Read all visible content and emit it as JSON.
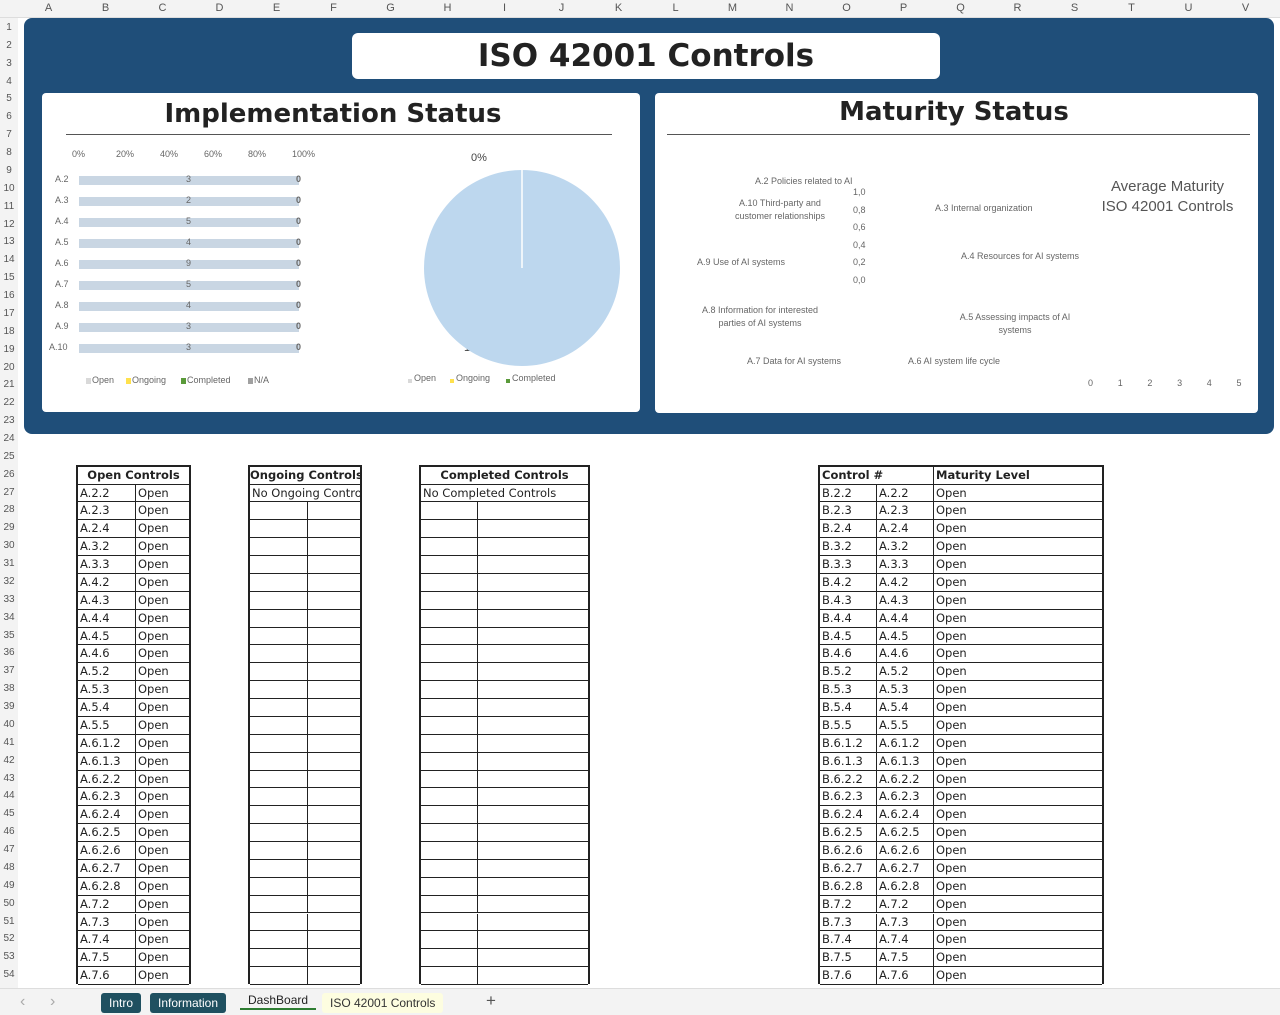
{
  "columns": [
    "A",
    "B",
    "C",
    "D",
    "E",
    "F",
    "G",
    "H",
    "I",
    "J",
    "K",
    "L",
    "M",
    "N",
    "O",
    "P",
    "Q",
    "R",
    "S",
    "T",
    "U",
    "V"
  ],
  "row_count": 54,
  "dashboard": {
    "title": "ISO 42001 Controls",
    "implementation_title": "Implementation Status",
    "maturity_title": "Maturity Status",
    "colors": {
      "background": "#1f4e79",
      "bar": "#c9d6e3",
      "pie": "#bdd7ee"
    }
  },
  "chart_data": [
    {
      "type": "bar",
      "stacked_percent": true,
      "categories": [
        "A.2",
        "A.3",
        "A.4",
        "A.5",
        "A.6",
        "A.7",
        "A.8",
        "A.9",
        "A.10"
      ],
      "xticks": [
        "0%",
        "20%",
        "40%",
        "60%",
        "80%",
        "100%"
      ],
      "series": [
        {
          "name": "Open",
          "values": [
            3,
            2,
            5,
            4,
            9,
            5,
            4,
            3,
            3
          ]
        },
        {
          "name": "Ongoing",
          "values": [
            0,
            0,
            0,
            0,
            0,
            0,
            0,
            0,
            0
          ]
        },
        {
          "name": "Completed",
          "values": [
            0,
            0,
            0,
            0,
            0,
            0,
            0,
            0,
            0
          ]
        },
        {
          "name": "N/A",
          "values": [
            0,
            0,
            0,
            0,
            0,
            0,
            0,
            0,
            0
          ]
        }
      ],
      "end_labels": [
        "0",
        "0",
        "0",
        "0",
        "0",
        "0",
        "0",
        "0",
        "0"
      ],
      "legend": [
        "Open",
        "Ongoing",
        "Completed",
        "N/A"
      ],
      "legend_position": "bottom"
    },
    {
      "type": "pie",
      "slices": [
        {
          "name": "Open",
          "value": 100,
          "label": "100%"
        },
        {
          "name": "Ongoing",
          "value": 0,
          "label": "0%"
        },
        {
          "name": "Completed",
          "value": 0,
          "label": ""
        }
      ],
      "legend": [
        "Open",
        "Ongoing",
        "Completed"
      ],
      "legend_position": "bottom"
    },
    {
      "type": "radar",
      "axes": [
        "A.2 Policies related to AI",
        "A.3 Internal organization",
        "A.4 Resources for AI systems",
        "A.5 Assessing impacts of AI systems",
        "A.6 AI system life cycle",
        "A.7 Data for AI systems",
        "A.8 Information for interested parties of AI systems",
        "A.9 Use of AI systems",
        "A.10 Third-party and customer relationships"
      ],
      "rticks": [
        "1,0",
        "0,8",
        "0,6",
        "0,4",
        "0,2",
        "0,0"
      ],
      "ylim": [
        0,
        1
      ]
    },
    {
      "type": "bar",
      "title": "Average Maturity ISO 42001 Controls",
      "title_lines": [
        "Average Maturity",
        "ISO 42001 Controls"
      ],
      "xticks": [
        "0",
        "1",
        "2",
        "3",
        "4",
        "5"
      ],
      "xlim": [
        0,
        5
      ],
      "values": []
    }
  ],
  "open_controls": {
    "header": "Open Controls",
    "ids": [
      "A.2.2",
      "A.2.3",
      "A.2.4",
      "A.3.2",
      "A.3.3",
      "A.4.2",
      "A.4.3",
      "A.4.4",
      "A.4.5",
      "A.4.6",
      "A.5.2",
      "A.5.3",
      "A.5.4",
      "A.5.5",
      "A.6.1.2",
      "A.6.1.3",
      "A.6.2.2",
      "A.6.2.3",
      "A.6.2.4",
      "A.6.2.5",
      "A.6.2.6",
      "A.6.2.7",
      "A.6.2.8",
      "A.7.2",
      "A.7.3",
      "A.7.4",
      "A.7.5",
      "A.7.6"
    ],
    "status": "Open"
  },
  "ongoing_controls": {
    "header": "Ongoing Controls",
    "empty": "No Ongoing Controls"
  },
  "completed_controls": {
    "header": "Completed Controls",
    "empty": "No Completed Controls"
  },
  "maturity_table": {
    "headers": [
      "Control #",
      "Maturity Level"
    ],
    "b_ids": [
      "B.2.2",
      "B.2.3",
      "B.2.4",
      "B.3.2",
      "B.3.3",
      "B.4.2",
      "B.4.3",
      "B.4.4",
      "B.4.5",
      "B.4.6",
      "B.5.2",
      "B.5.3",
      "B.5.4",
      "B.5.5",
      "B.6.1.2",
      "B.6.1.3",
      "B.6.2.2",
      "B.6.2.3",
      "B.6.2.4",
      "B.6.2.5",
      "B.6.2.6",
      "B.6.2.7",
      "B.6.2.8",
      "B.7.2",
      "B.7.3",
      "B.7.4",
      "B.7.5",
      "B.7.6"
    ],
    "level": "Open"
  },
  "sheet_tabs": [
    {
      "label": "Intro",
      "active": false
    },
    {
      "label": "Information",
      "active": false
    },
    {
      "label": "DashBoard",
      "active": true
    },
    {
      "label": "ISO 42001 Controls",
      "active": false
    }
  ],
  "add_sheet": "+",
  "nav_prev": "‹",
  "nav_next": "›"
}
